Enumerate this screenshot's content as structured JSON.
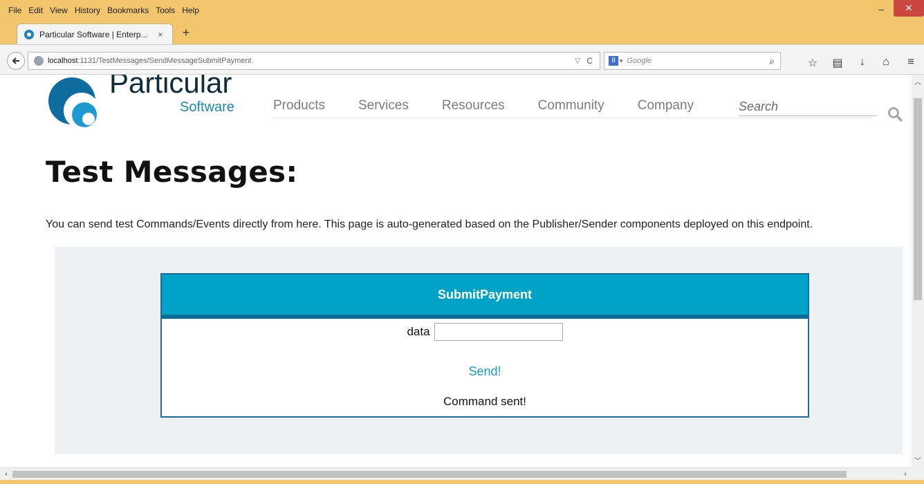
{
  "window": {
    "menu": [
      "File",
      "Edit",
      "View",
      "History",
      "Bookmarks",
      "Tools",
      "Help"
    ],
    "minimize_label": "–",
    "maximize_label": "☐",
    "close_label": "✕"
  },
  "tabs": [
    {
      "title": "Particular Software | Enterp...",
      "close_label": "×"
    }
  ],
  "new_tab_label": "+",
  "navbar": {
    "url_host": "localhost",
    "url_rest": ":1131/TestMessages/SendMessageSubmitPayment",
    "search_placeholder": "Google"
  },
  "site": {
    "brand": "Particular",
    "brand_sub": "Software",
    "nav": [
      "Products",
      "Services",
      "Resources",
      "Community",
      "Company"
    ],
    "search_placeholder": "Search"
  },
  "page": {
    "title": "Test Messages:",
    "description": "You can send test Commands/Events directly from here. This page is auto-generated based on the Publisher/Sender components deployed on this endpoint.",
    "card": {
      "header": "SubmitPayment",
      "field_label": "data",
      "field_value": "",
      "send_label": "Send!",
      "status": "Command sent!"
    }
  },
  "colors": {
    "frame": "#f2c66c",
    "accent": "#00a2c6",
    "accent_dark": "#0b6a96",
    "link": "#16a0c4"
  }
}
